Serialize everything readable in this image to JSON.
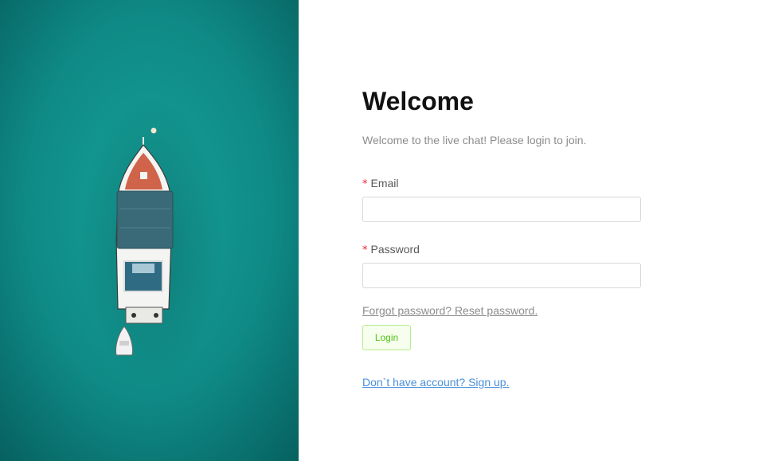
{
  "hero": {
    "image_subject": "aerial view of a white boat on teal sea",
    "sea_color": "#0f8a86"
  },
  "form": {
    "title": "Welcome",
    "subtitle": "Welcome to the live chat! Please login to join.",
    "required_mark": "*",
    "email_label": "Email",
    "email_value": "",
    "email_placeholder": "",
    "password_label": "Password",
    "password_value": "",
    "password_placeholder": "",
    "forgot_link": "Forgot password? Reset password.",
    "login_button": "Login",
    "signup_link": "Don`t have account? Sign up."
  },
  "colors": {
    "required": "#f5222d",
    "login_text": "#52c41a",
    "login_bg": "#f6ffed",
    "login_border": "#b7eb8f",
    "link": "#4a90d9"
  }
}
